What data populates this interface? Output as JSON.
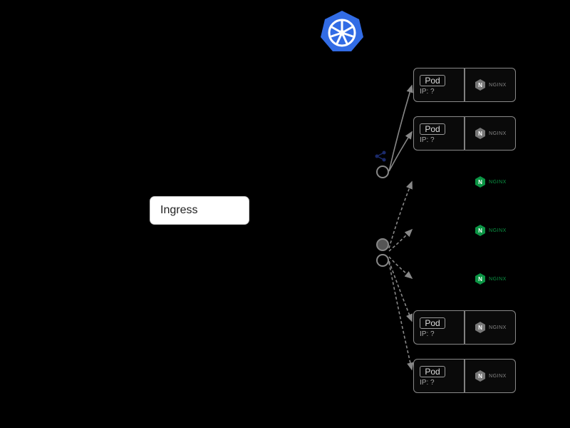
{
  "diagram": {
    "ingress_label": "Ingress",
    "k8s_icon": "kubernetes-wheel",
    "service_nodes": [
      {
        "id": "svc-a",
        "active": false
      },
      {
        "id": "svc-b",
        "active": true
      },
      {
        "id": "svc-c",
        "active": false
      }
    ],
    "pods": [
      {
        "name": "Pod",
        "ip": "IP: ?",
        "nginx": "NGINX",
        "variant": "grey",
        "show_box": true
      },
      {
        "name": "Pod",
        "ip": "IP: ?",
        "nginx": "NGINX",
        "variant": "grey",
        "show_box": true
      },
      {
        "name": "",
        "ip": "",
        "nginx": "NGINX",
        "variant": "green",
        "show_box": false
      },
      {
        "name": "",
        "ip": "",
        "nginx": "NGINX",
        "variant": "green",
        "show_box": false
      },
      {
        "name": "",
        "ip": "",
        "nginx": "NGINX",
        "variant": "green",
        "show_box": false
      },
      {
        "name": "Pod",
        "ip": "IP: ?",
        "nginx": "NGINX",
        "variant": "grey",
        "show_box": true
      },
      {
        "name": "Pod",
        "ip": "IP: ?",
        "nginx": "NGINX",
        "variant": "grey",
        "show_box": true
      }
    ]
  }
}
